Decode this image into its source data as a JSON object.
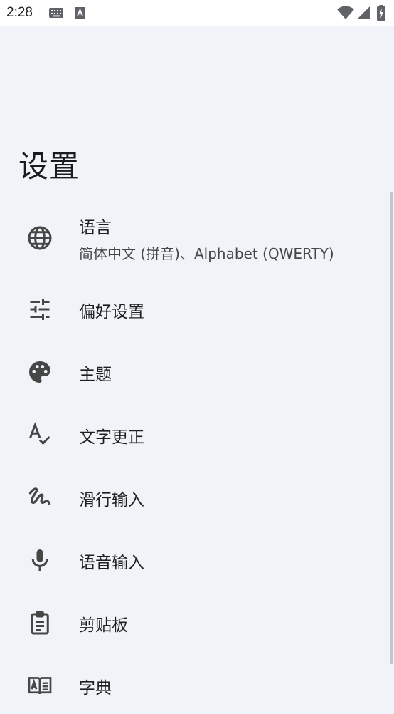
{
  "status_bar": {
    "time": "2:28",
    "icons": [
      "keyboard-icon",
      "font-a-icon",
      "wifi-icon",
      "signal-icon",
      "battery-charging-icon"
    ]
  },
  "page": {
    "title": "设置"
  },
  "settings": [
    {
      "name": "language",
      "icon": "globe-icon",
      "title": "语言",
      "subtitle": "简体中文 (拼音)、Alphabet (QWERTY)"
    },
    {
      "name": "preferences",
      "icon": "tune-icon",
      "title": "偏好设置"
    },
    {
      "name": "theme",
      "icon": "palette-icon",
      "title": "主题"
    },
    {
      "name": "text-correction",
      "icon": "spellcheck-icon",
      "title": "文字更正"
    },
    {
      "name": "glide-typing",
      "icon": "gesture-icon",
      "title": "滑行输入"
    },
    {
      "name": "voice-typing",
      "icon": "mic-icon",
      "title": "语音输入"
    },
    {
      "name": "clipboard",
      "icon": "clipboard-icon",
      "title": "剪贴板"
    },
    {
      "name": "dictionary",
      "icon": "dictionary-icon",
      "title": "字典"
    }
  ],
  "colors": {
    "background": "#f0f3f8",
    "status_bar": "#ffffff",
    "icon": "#444746",
    "text": "#1f1f1f",
    "scrollbar": "#c3c6cc"
  }
}
